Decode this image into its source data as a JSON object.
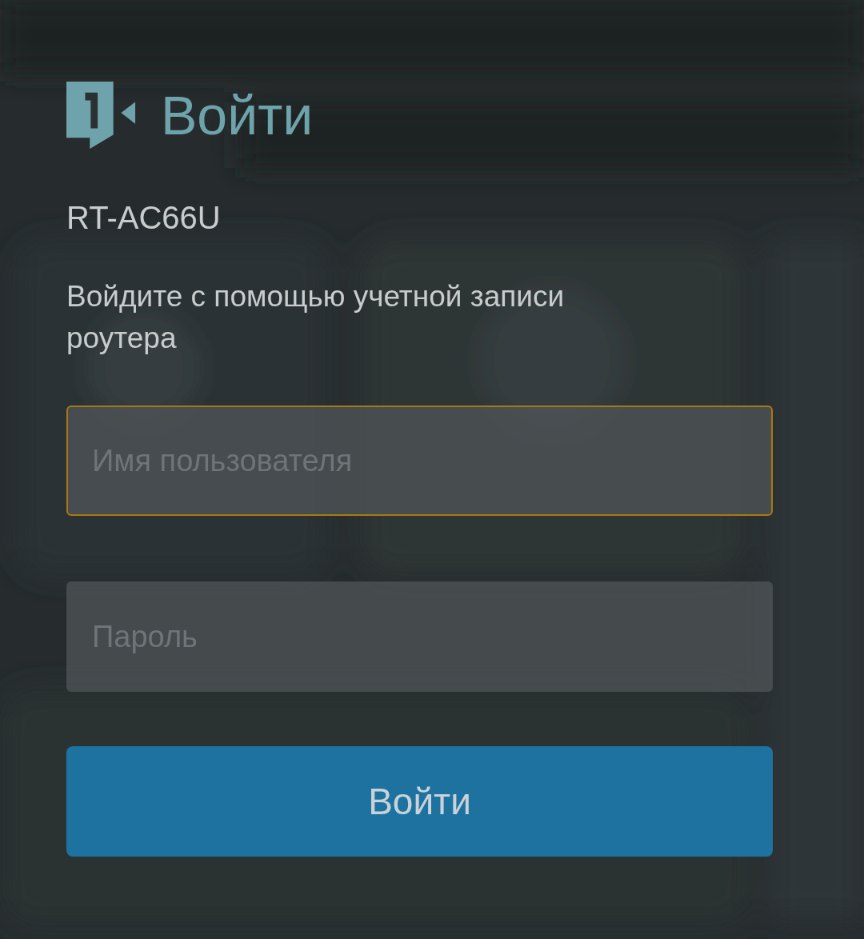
{
  "title": "Войти",
  "device": "RT-AC66U",
  "description": "Войдите с помощью учетной записи роутера",
  "fields": [
    {
      "placeholder": "Имя пользователя",
      "focused": true
    },
    {
      "placeholder": "Пароль",
      "focused": false
    }
  ],
  "submit_button": "Войти"
}
